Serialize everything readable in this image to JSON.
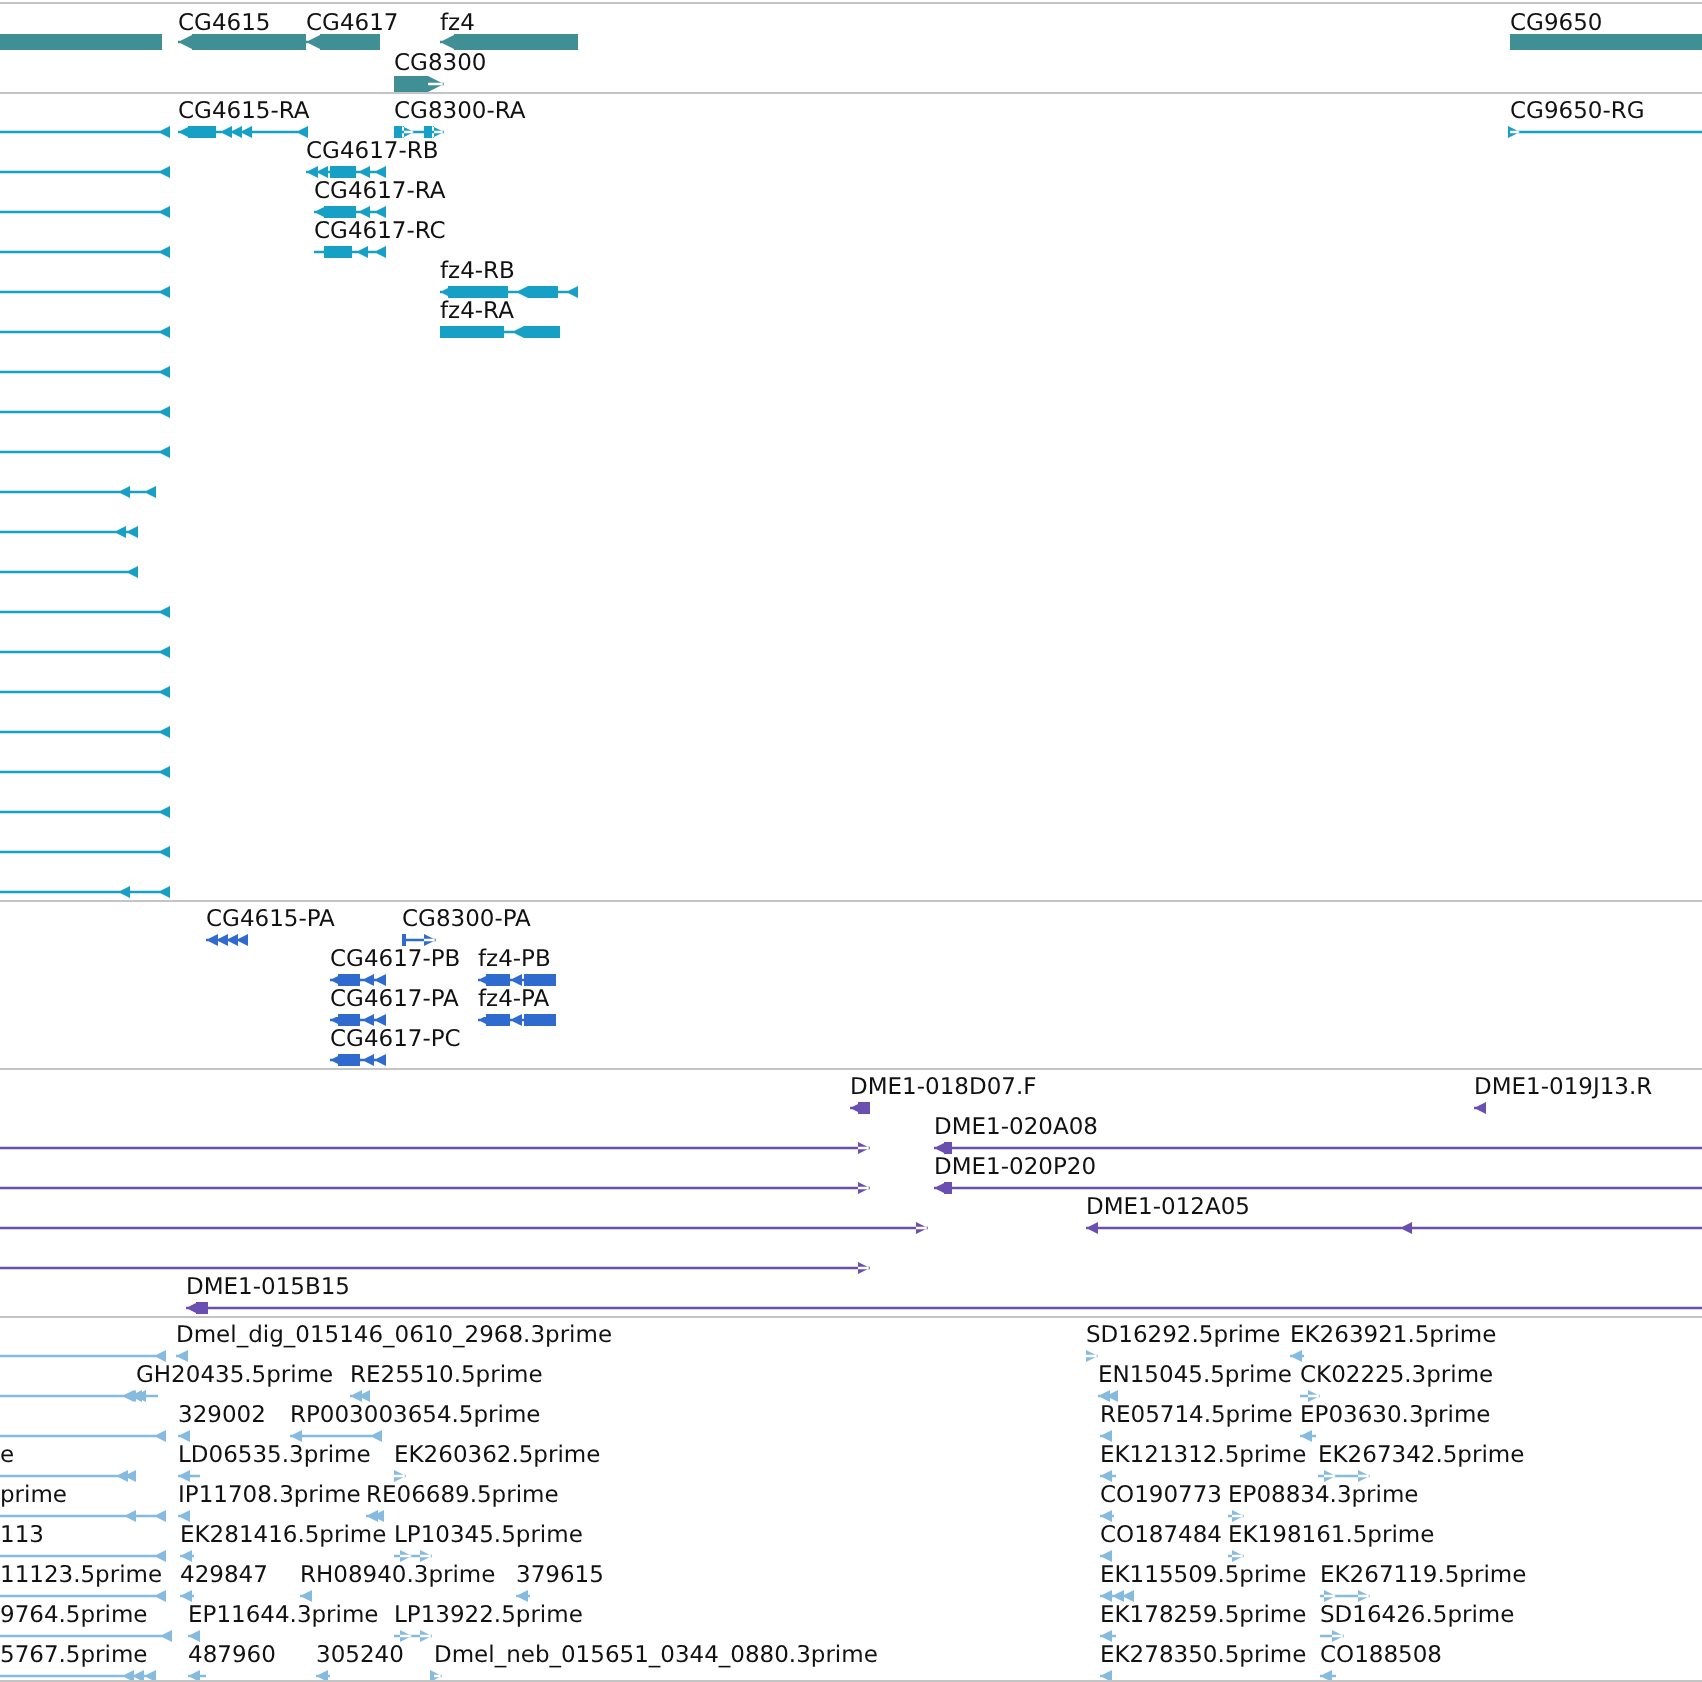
{
  "tracks": [
    {
      "kind": "gene",
      "features": [
        {
          "label": "CG4615"
        },
        {
          "label": "CG4617"
        },
        {
          "label": "fz4"
        },
        {
          "label": "CG8300"
        },
        {
          "label": "CG9650"
        }
      ]
    },
    {
      "kind": "transcript",
      "features": [
        {
          "label": "CG4615-RA"
        },
        {
          "label": "CG8300-RA"
        },
        {
          "label": "CG9650-RG"
        },
        {
          "label": "CG4617-RB"
        },
        {
          "label": "CG4617-RA"
        },
        {
          "label": "CG4617-RC"
        },
        {
          "label": "fz4-RB"
        },
        {
          "label": "fz4-RA"
        }
      ]
    },
    {
      "kind": "protein",
      "features": [
        {
          "label": "CG4615-PA"
        },
        {
          "label": "CG8300-PA"
        },
        {
          "label": "CG4617-PB"
        },
        {
          "label": "fz4-PB"
        },
        {
          "label": "CG4617-PA"
        },
        {
          "label": "fz4-PA"
        },
        {
          "label": "CG4617-PC"
        }
      ]
    },
    {
      "kind": "clone",
      "features": [
        {
          "label": "DME1-018D07.F"
        },
        {
          "label": "DME1-019J13.R"
        },
        {
          "label": "DME1-020A08"
        },
        {
          "label": "DME1-020P20"
        },
        {
          "label": "DME1-012A05"
        },
        {
          "label": "DME1-015B15"
        }
      ]
    },
    {
      "kind": "est",
      "features": [
        {
          "label": "Dmel_dig_015146_0610_2968.3prime"
        },
        {
          "label": "SD16292.5prime"
        },
        {
          "label": "EK263921.5prime"
        },
        {
          "label": "GH20435.5prime"
        },
        {
          "label": "RE25510.5prime"
        },
        {
          "label": "EN15045.5prime"
        },
        {
          "label": "CK02225.3prime"
        },
        {
          "label": "329002"
        },
        {
          "label": "RP003003654.5prime"
        },
        {
          "label": "RE05714.5prime"
        },
        {
          "label": "EP03630.3prime"
        },
        {
          "label": "e"
        },
        {
          "label": "LD06535.3prime"
        },
        {
          "label": "EK260362.5prime"
        },
        {
          "label": "EK121312.5prime"
        },
        {
          "label": "EK267342.5prime"
        },
        {
          "label": "prime"
        },
        {
          "label": "IP11708.3prime"
        },
        {
          "label": "RE06689.5prime"
        },
        {
          "label": "CO190773"
        },
        {
          "label": "EP08834.3prime"
        },
        {
          "label": "113"
        },
        {
          "label": "EK281416.5prime"
        },
        {
          "label": "LP10345.5prime"
        },
        {
          "label": "CO187484"
        },
        {
          "label": "EK198161.5prime"
        },
        {
          "label": "11123.5prime"
        },
        {
          "label": "429847"
        },
        {
          "label": "RH08940.3prime"
        },
        {
          "label": "379615"
        },
        {
          "label": "EK115509.5prime"
        },
        {
          "label": "EK267119.5prime"
        },
        {
          "label": "9764.5prime"
        },
        {
          "label": "EP11644.3prime"
        },
        {
          "label": "LP13922.5prime"
        },
        {
          "label": "EK178259.5prime"
        },
        {
          "label": "SD16426.5prime"
        },
        {
          "label": "5767.5prime"
        },
        {
          "label": "487960"
        },
        {
          "label": "305240"
        },
        {
          "label": "Dmel_neb_015651_0344_0880.3prime"
        },
        {
          "label": "EK278350.5prime"
        },
        {
          "label": "CO188508"
        }
      ]
    }
  ]
}
